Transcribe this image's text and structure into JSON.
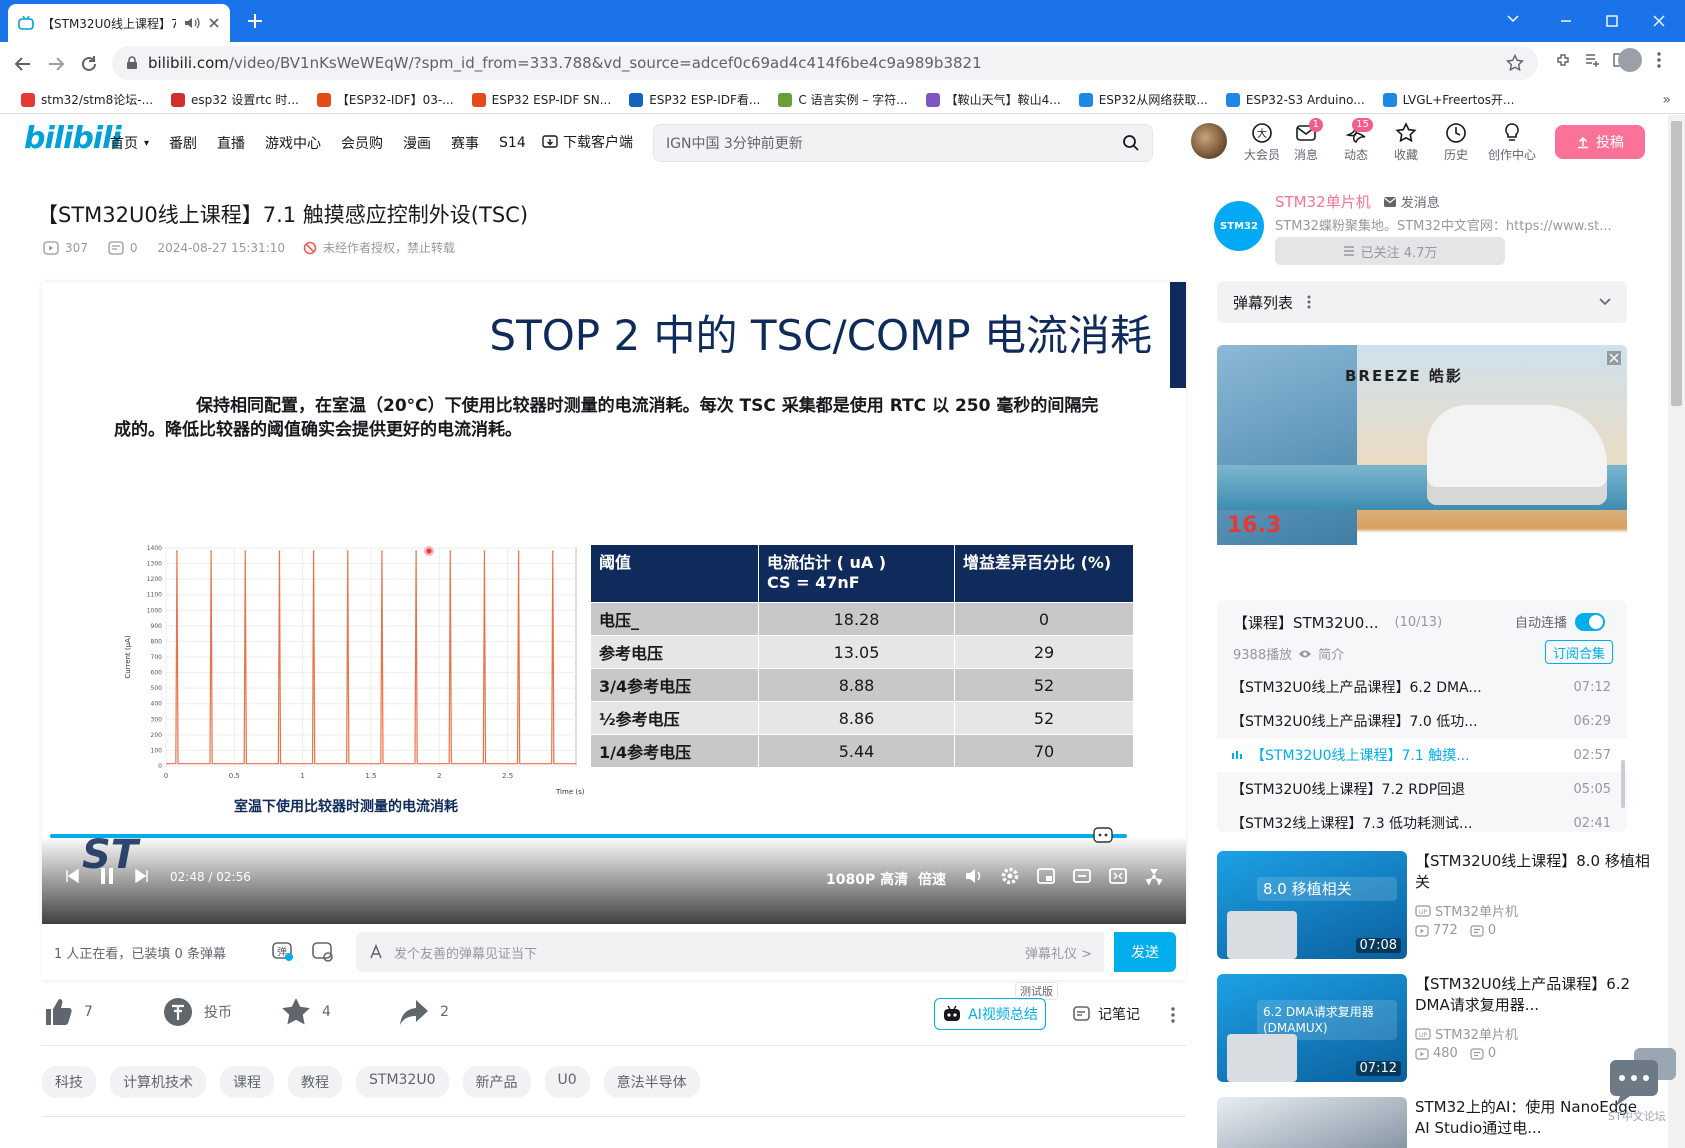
{
  "browser": {
    "tab_title": "【STM32U0线上课程】7",
    "url_domain": "bilibili.com",
    "url_path": "/video/BV1nKsWeWEqW/?spm_id_from=333.788&vd_source=adcef0c69ad4c414f6be4c9a989b3821",
    "bookmarks": [
      {
        "label": "stm32/stm8论坛-...",
        "color": "#e53935"
      },
      {
        "label": "esp32 设置rtc 时...",
        "color": "#d32f2f"
      },
      {
        "label": "【ESP32-IDF】03-...",
        "color": "#e64a19"
      },
      {
        "label": "ESP32 ESP-IDF SN...",
        "color": "#e64a19"
      },
      {
        "label": "ESP32 ESP-IDF看...",
        "color": "#1565c0"
      },
      {
        "label": "C 语言实例 – 字符...",
        "color": "#689f38"
      },
      {
        "label": "【鞍山天气】鞍山4...",
        "color": "#7e57c2"
      },
      {
        "label": "ESP32从网络获取...",
        "color": "#1e88e5"
      },
      {
        "label": "ESP32-S3 Arduino...",
        "color": "#1e88e5"
      },
      {
        "label": "LVGL+Freertos开...",
        "color": "#1e88e5"
      }
    ]
  },
  "header": {
    "logo": "bilibili",
    "nav": [
      "首页",
      "番剧",
      "直播",
      "游戏中心",
      "会员购",
      "漫画",
      "赛事",
      "S14"
    ],
    "download": "下载客户端",
    "search_placeholder": "IGN中国 3分钟前更新",
    "icons": [
      {
        "label": "大会员",
        "badge": ""
      },
      {
        "label": "消息",
        "badge": "1"
      },
      {
        "label": "动态",
        "badge": "15"
      },
      {
        "label": "收藏",
        "badge": ""
      },
      {
        "label": "历史",
        "badge": ""
      },
      {
        "label": "创作中心",
        "badge": ""
      }
    ],
    "upload": "投稿"
  },
  "video": {
    "title": "【STM32U0线上课程】7.1 触摸感应控制外设(TSC)",
    "views": "307",
    "danmaku": "0",
    "date": "2024-08-27 15:31:10",
    "copyright": "未经作者授权，禁止转载",
    "slide_title": "STOP 2 中的 TSC/COMP 电流消耗",
    "slide_text": "保持相同配置，在室温（20°C）下使用比较器时测量的电流消耗。每次 TSC 采集都是使用 RTC 以 250 毫秒的间隔完成的。降低比较器的阈值确实会提供更好的电流消耗。",
    "plot_caption": "室温下使用比较器时测量的电流消耗",
    "table": {
      "headers": [
        "阈值",
        "电流估计 ( uA )\nCS = 47nF",
        "增益差异百分比 (%)"
      ],
      "rows": [
        [
          "电压_",
          "18.28",
          "0"
        ],
        [
          "参考电压",
          "13.05",
          "29"
        ],
        [
          "3/4参考电压",
          "8.88",
          "52"
        ],
        [
          "½参考电压",
          "8.86",
          "52"
        ],
        [
          "1/4参考电压",
          "5.44",
          "70"
        ]
      ]
    },
    "time_current": "02:48",
    "time_total": "02:56",
    "progress": 0.955,
    "quality": "1080P 高清",
    "speed": "倍速"
  },
  "chart_data": {
    "type": "line",
    "xlabel": "Time (s)",
    "ylabel": "Current (µA)",
    "xlim": [
      0,
      3
    ],
    "ylim": [
      0,
      1400
    ],
    "x_ticks": [
      "0",
      "0.5",
      "1",
      "1.5",
      "2",
      "2.5"
    ],
    "y_ticks": [
      "0",
      "100",
      "200",
      "300",
      "400",
      "500",
      "600",
      "700",
      "800",
      "900",
      "1000",
      "1100",
      "1200",
      "1300",
      "1400"
    ],
    "series": [
      {
        "name": "",
        "color": "#e8734a",
        "spikes_x": [
          0.08,
          0.33,
          0.58,
          0.83,
          1.08,
          1.33,
          1.58,
          1.83,
          2.08,
          2.33,
          2.58,
          2.83
        ],
        "spike_y": 1380,
        "baseline_y": 15
      }
    ]
  },
  "danmaku_bar": {
    "watching": "1 人正在看，已装填 0 条弹幕",
    "placeholder": "发个友善的弹幕见证当下",
    "etiquette": "弹幕礼仪 >",
    "send": "发送"
  },
  "actions": {
    "like": "7",
    "coin": "投币",
    "fav": "4",
    "share": "2",
    "ai_beta": "测试版",
    "ai_summary": "AI视频总结",
    "notes": "记笔记"
  },
  "tags": [
    "科技",
    "计算机技术",
    "课程",
    "教程",
    "STM32U0",
    "新产品",
    "U0",
    "意法半导体"
  ],
  "uploader": {
    "name": "STM32单片机",
    "message": "发消息",
    "desc": "STM32蝶粉聚集地。STM32中文官网：https://www.st...",
    "follow": "已关注 4.7万",
    "avatar_text": "STM32"
  },
  "danmaku_list": {
    "label": "弹幕列表"
  },
  "ad": {
    "brand": "BREEZE 皓影",
    "price": "16.3"
  },
  "playlist": {
    "title": "【课程】STM32U0...",
    "count": "(10/13)",
    "autoplay": "自动连播",
    "plays": "9388播放",
    "intro": "简介",
    "subscribe": "订阅合集",
    "items": [
      {
        "title": "【STM32U0线上产品课程】6.2 DMA...",
        "time": "07:12",
        "active": false
      },
      {
        "title": "【STM32U0线上产品课程】7.0 低功...",
        "time": "06:29",
        "active": false
      },
      {
        "title": "【STM32U0线上课程】7.1 触摸...",
        "time": "02:57",
        "active": true
      },
      {
        "title": "【STM32U0线上课程】7.2 RDP回退",
        "time": "05:05",
        "active": false
      },
      {
        "title": "【STM32线上课程】7.3 低功耗测试...",
        "time": "02:41",
        "active": false
      }
    ]
  },
  "recommend": [
    {
      "title": "【STM32U0线上课程】8.0 移植相关",
      "thumb_text": "8.0 移植相关",
      "duration": "07:08",
      "up": "STM32单片机",
      "views": "772",
      "dm": "0"
    },
    {
      "title": "【STM32U0线上产品课程】6.2 DMA请求复用器...",
      "thumb_text": "6.2 DMA请求复用器 (DMAMUX)",
      "duration": "07:12",
      "up": "STM32单片机",
      "views": "480",
      "dm": "0"
    },
    {
      "title": "STM32上的AI：使用 NanoEdge AI Studio通过电...",
      "thumb_text": "",
      "duration": "",
      "up": "",
      "views": "",
      "dm": ""
    }
  ],
  "forum_widget": "ST中文论坛"
}
